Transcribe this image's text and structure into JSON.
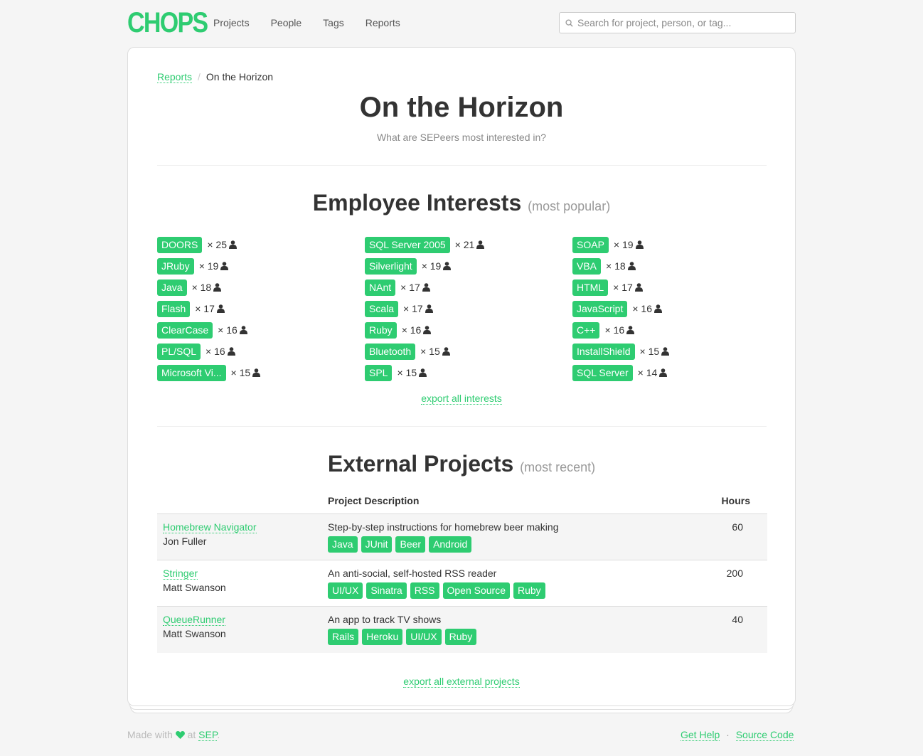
{
  "app": {
    "logo": "CHOPS"
  },
  "nav": {
    "items": [
      {
        "label": "Projects"
      },
      {
        "label": "People"
      },
      {
        "label": "Tags"
      },
      {
        "label": "Reports"
      }
    ]
  },
  "search": {
    "placeholder": "Search for project, person, or tag..."
  },
  "breadcrumb": {
    "parent": "Reports",
    "separator": "/",
    "current": "On the Horizon"
  },
  "page": {
    "title": "On the Horizon",
    "subtitle": "What are SEPeers most interested in?"
  },
  "interests": {
    "title": "Employee Interests",
    "qualifier": "(most popular)",
    "columns": [
      [
        {
          "tag": "DOORS",
          "count": "× 25"
        },
        {
          "tag": "JRuby",
          "count": "× 19"
        },
        {
          "tag": "Java",
          "count": "× 18"
        },
        {
          "tag": "Flash",
          "count": "× 17"
        },
        {
          "tag": "ClearCase",
          "count": "× 16"
        },
        {
          "tag": "PL/SQL",
          "count": "× 16"
        },
        {
          "tag": "Microsoft Vi...",
          "count": "× 15"
        }
      ],
      [
        {
          "tag": "SQL Server 2005",
          "count": "× 21"
        },
        {
          "tag": "Silverlight",
          "count": "× 19"
        },
        {
          "tag": "NAnt",
          "count": "× 17"
        },
        {
          "tag": "Scala",
          "count": "× 17"
        },
        {
          "tag": "Ruby",
          "count": "× 16"
        },
        {
          "tag": "Bluetooth",
          "count": "× 15"
        },
        {
          "tag": "SPL",
          "count": "× 15"
        }
      ],
      [
        {
          "tag": "SOAP",
          "count": "× 19"
        },
        {
          "tag": "VBA",
          "count": "× 18"
        },
        {
          "tag": "HTML",
          "count": "× 17"
        },
        {
          "tag": "JavaScript",
          "count": "× 16"
        },
        {
          "tag": "C++",
          "count": "× 16"
        },
        {
          "tag": "InstallShield",
          "count": "× 15"
        },
        {
          "tag": "SQL Server",
          "count": "× 14"
        }
      ]
    ],
    "export_label": "export all interests"
  },
  "projects": {
    "title": "External Projects",
    "qualifier": "(most recent)",
    "headers": {
      "description": "Project Description",
      "hours": "Hours"
    },
    "rows": [
      {
        "name": "Homebrew Navigator",
        "person": "Jon Fuller",
        "description": "Step-by-step instructions for homebrew beer making",
        "tags": [
          "Java",
          "JUnit",
          "Beer",
          "Android"
        ],
        "hours": "60"
      },
      {
        "name": "Stringer",
        "person": "Matt Swanson",
        "description": "An anti-social, self-hosted RSS reader",
        "tags": [
          "UI/UX",
          "Sinatra",
          "RSS",
          "Open Source",
          "Ruby"
        ],
        "hours": "200"
      },
      {
        "name": "QueueRunner",
        "person": "Matt Swanson",
        "description": "An app to track TV shows",
        "tags": [
          "Rails",
          "Heroku",
          "UI/UX",
          "Ruby"
        ],
        "hours": "40"
      }
    ],
    "export_label": "export all external projects"
  },
  "footer": {
    "made_with": "Made with",
    "at": "at",
    "org": "SEP",
    "period": ".",
    "get_help": "Get Help",
    "dot": "·",
    "source_code": "Source Code"
  },
  "colors": {
    "accent": "#2ecc71"
  }
}
